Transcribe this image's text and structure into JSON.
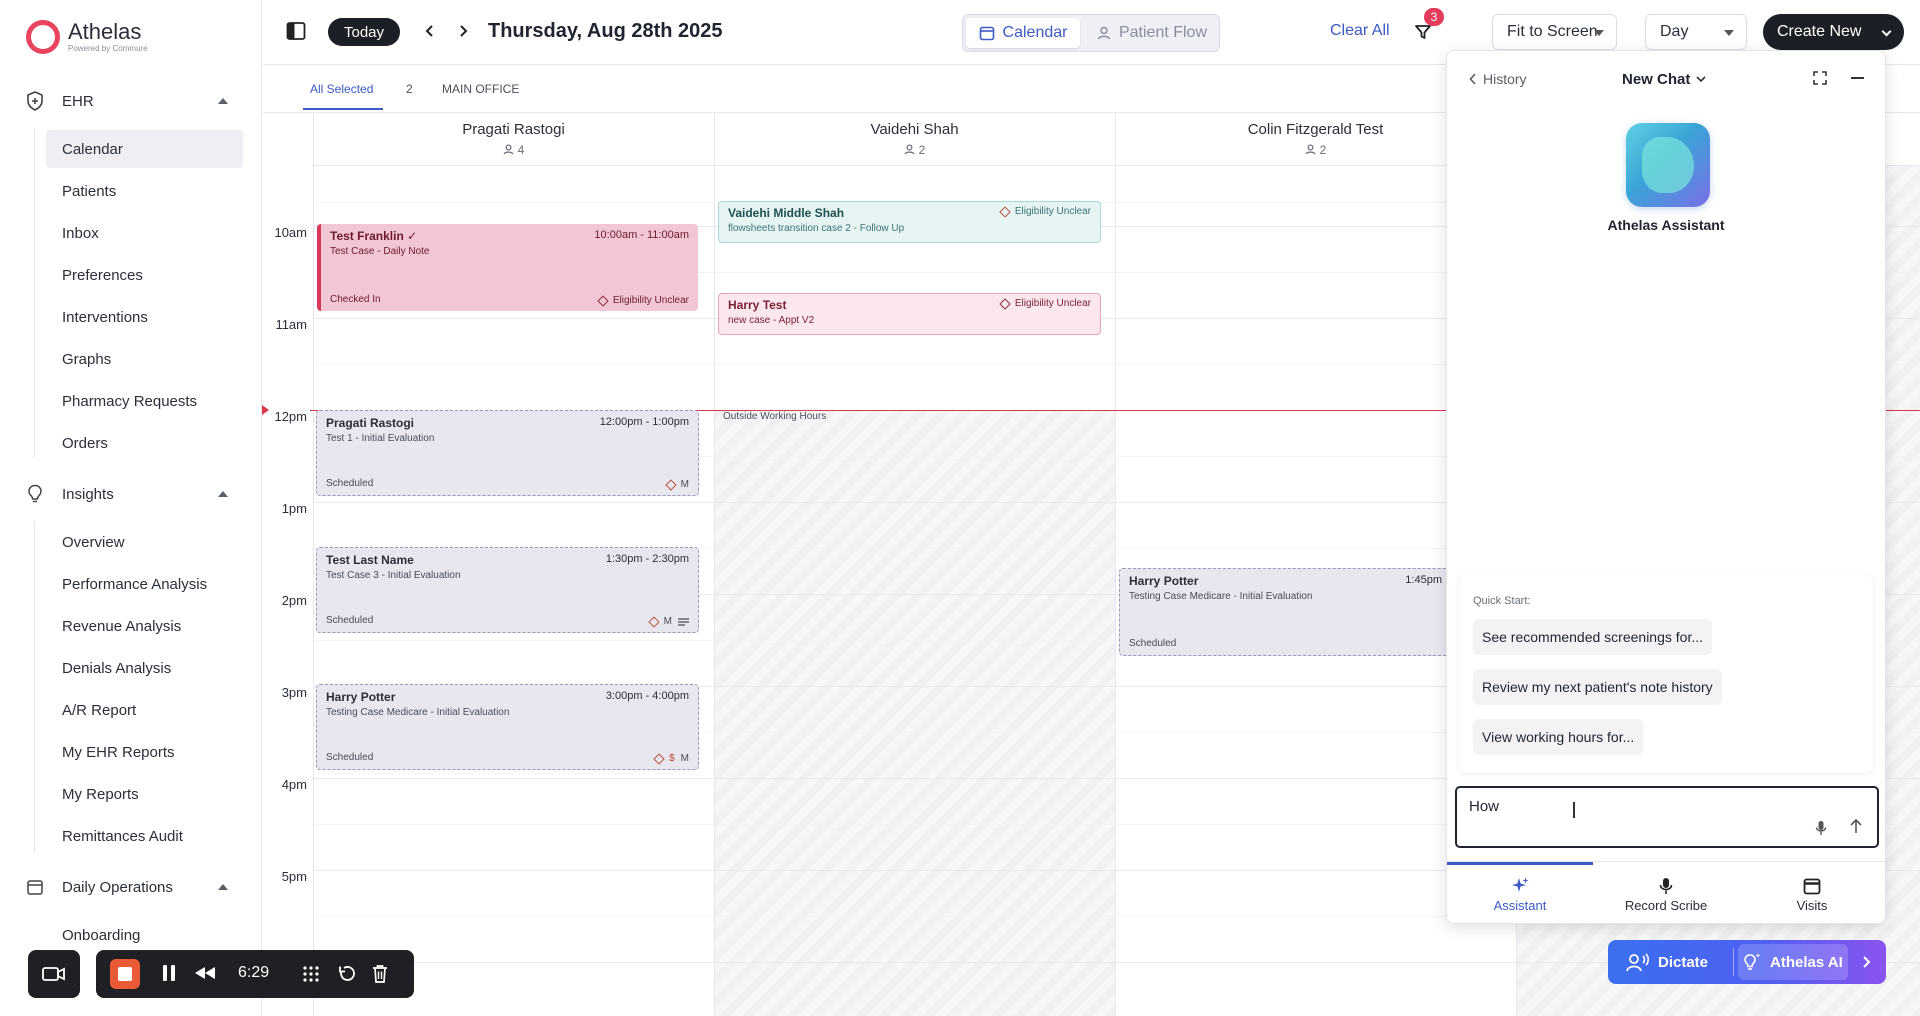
{
  "brand": {
    "name": "Athelas",
    "tagline": "Powered by Commure"
  },
  "sidebar": {
    "sections": [
      {
        "label": "EHR",
        "items": [
          "Calendar",
          "Patients",
          "Inbox",
          "Preferences",
          "Interventions",
          "Graphs",
          "Pharmacy Requests",
          "Orders"
        ]
      },
      {
        "label": "Insights",
        "items": [
          "Overview",
          "Performance Analysis",
          "Revenue Analysis",
          "Denials Analysis",
          "A/R Report",
          "My EHR Reports",
          "My Reports",
          "Remittances Audit"
        ]
      },
      {
        "label": "Daily Operations",
        "items": [
          "Onboarding"
        ]
      }
    ],
    "active_item": "Calendar"
  },
  "topbar": {
    "today_label": "Today",
    "date_title": "Thursday, Aug 28th 2025",
    "view_toggle": {
      "calendar": "Calendar",
      "patient_flow": "Patient Flow"
    },
    "clear_all": "Clear All",
    "filter_count": "3",
    "fit_label": "Fit to Screen",
    "range_label": "Day",
    "create_label": "Create New"
  },
  "filters": {
    "all_selected": "All Selected",
    "count": "2",
    "office": "MAIN OFFICE"
  },
  "calendar": {
    "times": [
      "10am",
      "11am",
      "12pm",
      "1pm",
      "2pm",
      "3pm",
      "4pm",
      "5pm"
    ],
    "columns": [
      {
        "name": "Pragati Rastogi",
        "count": "4"
      },
      {
        "name": "Vaidehi Shah",
        "count": "2"
      },
      {
        "name": "Colin Fitzgerald Test",
        "count": "2"
      }
    ],
    "outside_label": "Outside Working Hours",
    "appointments": {
      "a1": {
        "name": "Test Franklin",
        "check": "✓",
        "time": "10:00am - 11:00am",
        "sub": "Test Case - Daily Note",
        "status": "Checked In",
        "flag": "Eligibility Unclear"
      },
      "a2": {
        "name": "Pragati Rastogi",
        "time": "12:00pm - 1:00pm",
        "sub": "Test 1 - Initial Evaluation",
        "status": "Scheduled",
        "badges": "M"
      },
      "a3": {
        "name": "Test Last Name",
        "time": "1:30pm - 2:30pm",
        "sub": "Test Case 3 - Initial Evaluation",
        "status": "Scheduled",
        "badges": "M"
      },
      "a4": {
        "name": "Harry Potter",
        "time": "3:00pm - 4:00pm",
        "sub": "Testing Case Medicare - Initial Evaluation",
        "status": "Scheduled",
        "badge_dollar": "$",
        "badges": "M"
      },
      "b1": {
        "name": "Vaidehi Middle Shah",
        "sub": "flowsheets transition case 2 - Follow Up",
        "flag": "Eligibility Unclear"
      },
      "b2": {
        "name": "Harry Test",
        "sub": "new case - Appt V2",
        "flag": "Eligibility Unclear"
      },
      "c1": {
        "name": "Harry Potter",
        "time": "1:45pm",
        "sub": "Testing Case Medicare - Initial Evaluation",
        "status": "Scheduled"
      }
    }
  },
  "chat": {
    "history_label": "History",
    "title": "New Chat",
    "assistant_name": "Athelas Assistant",
    "quick_start_label": "Quick Start:",
    "quick_start": [
      "See recommended screenings for...",
      "Review my next patient's note history",
      "View working hours for..."
    ],
    "input_value": "How",
    "tabs": [
      "Assistant",
      "Record Scribe",
      "Visits"
    ]
  },
  "ai_bar": {
    "dictate": "Dictate",
    "athelas_ai": "Athelas AI"
  },
  "recorder": {
    "time": "6:29"
  },
  "colors": {
    "accent": "#3d5ac6",
    "brand": "#e8435f",
    "now_line": "#d73a4a"
  }
}
